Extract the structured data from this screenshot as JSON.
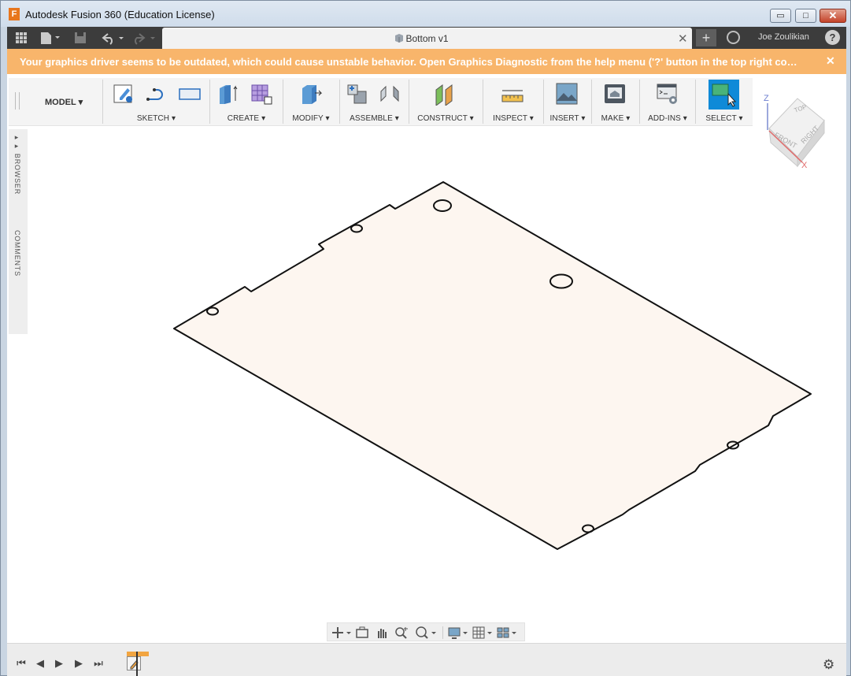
{
  "window": {
    "title": "Autodesk Fusion 360 (Education License)",
    "logo_letter": "F",
    "minimize": "▭",
    "maximize": "□",
    "close": "✕"
  },
  "quick_access": {
    "data_panel_icon": "grid-icon",
    "file_icon": "file-icon",
    "save_icon": "save-icon",
    "undo_icon": "undo-icon",
    "redo_icon": "redo-icon",
    "new_tab_symbol": "+",
    "user_name": "Joe Zoulikian",
    "help_symbol": "?"
  },
  "document_tab": {
    "label": "Bottom v1",
    "close_symbol": "✕"
  },
  "warning": {
    "text": "Your graphics driver seems to be outdated, which could cause unstable behavior. Open Graphics Diagnostic from the help menu ('?' button in the top right co…",
    "close_symbol": "✕",
    "color": "#f8b56b"
  },
  "ribbon": {
    "workspace": "MODEL ▾",
    "groups": [
      {
        "label": "SKETCH ▾"
      },
      {
        "label": "CREATE ▾"
      },
      {
        "label": "MODIFY ▾"
      },
      {
        "label": "ASSEMBLE ▾"
      },
      {
        "label": "CONSTRUCT ▾"
      },
      {
        "label": "INSPECT ▾"
      },
      {
        "label": "INSERT ▾"
      },
      {
        "label": "MAKE ▾"
      },
      {
        "label": "ADD-INS ▾"
      },
      {
        "label": "SELECT ▾"
      }
    ],
    "select_accent": "#0f8ad8"
  },
  "side_panel": {
    "browser": "BROWSER",
    "comments": "COMMENTS"
  },
  "viewcube": {
    "top": "TOP",
    "front": "FRONT",
    "right": "RIGHT",
    "z_axis": "Z",
    "x_axis": "X"
  },
  "timeline": {
    "first": "⏮",
    "prev": "◀",
    "play": "▶",
    "next": "▶",
    "last": "⏭"
  },
  "model": {
    "fill": "#fdf6f0",
    "stroke": "#111111"
  }
}
